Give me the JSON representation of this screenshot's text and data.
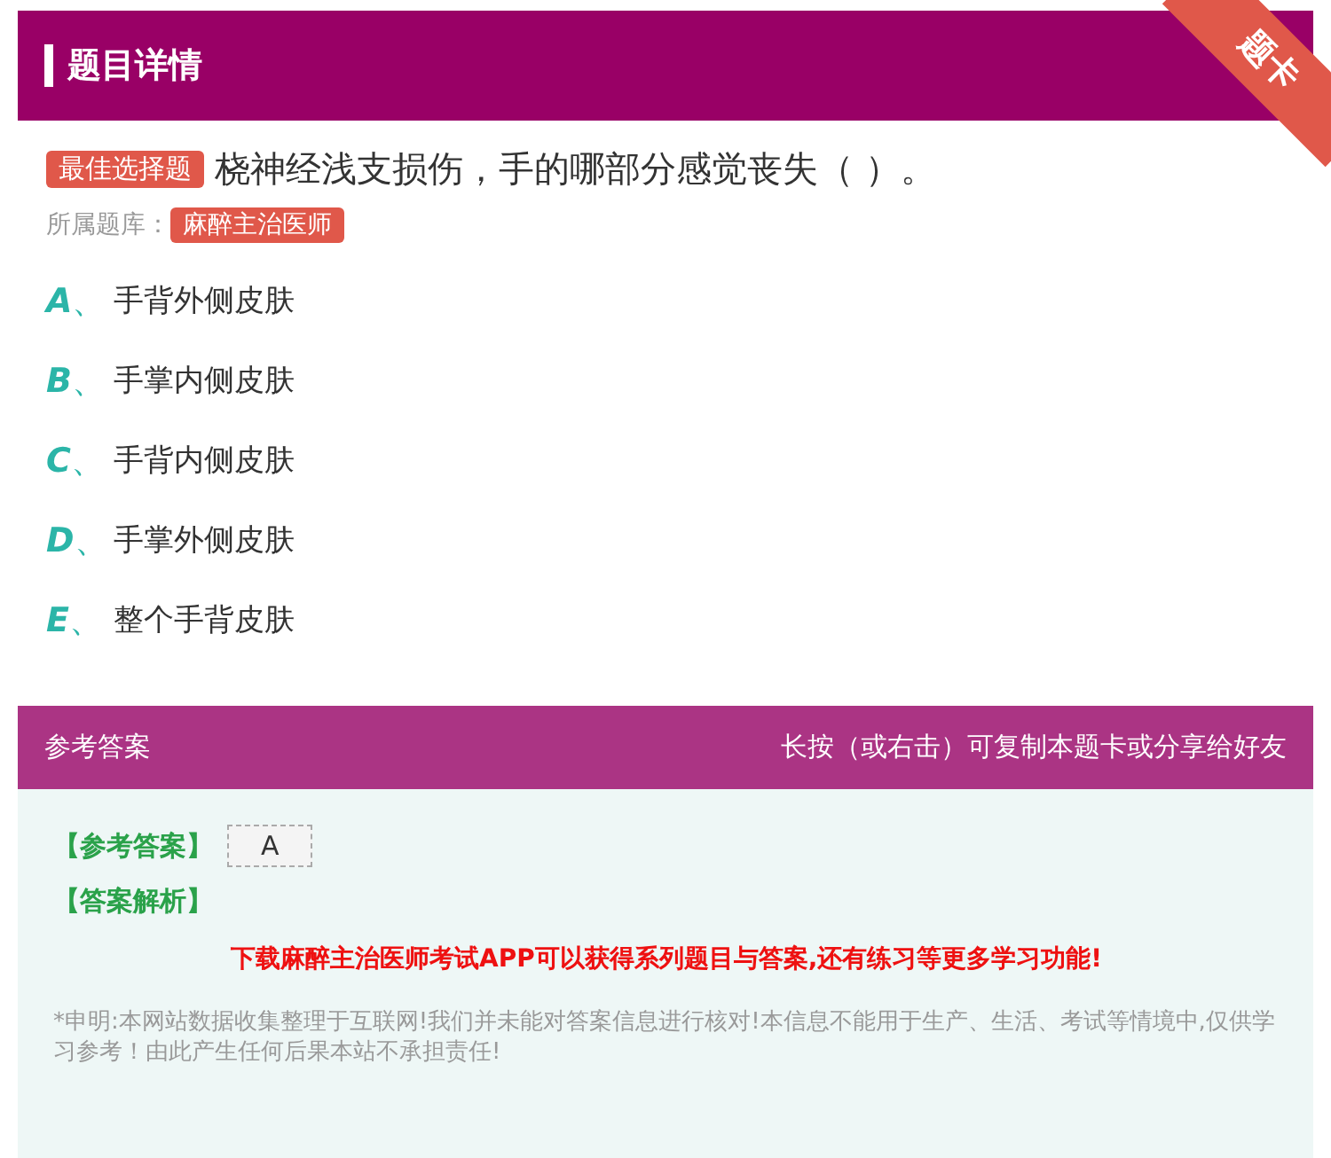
{
  "header": {
    "title": "题目详情",
    "ribbon": "题卡"
  },
  "question": {
    "type_badge": "最佳选择题",
    "text": "桡神经浅支损伤，手的哪部分感觉丧失（ ）。",
    "bank_label": "所属题库：",
    "bank": "麻醉主治医师"
  },
  "options": [
    {
      "letter": "A",
      "separator": "、",
      "text": "手背外侧皮肤"
    },
    {
      "letter": "B",
      "separator": "、",
      "text": "手掌内侧皮肤"
    },
    {
      "letter": "C",
      "separator": "、",
      "text": "手背内侧皮肤"
    },
    {
      "letter": "D",
      "separator": "、",
      "text": "手掌外侧皮肤"
    },
    {
      "letter": "E",
      "separator": "、",
      "text": "整个手背皮肤"
    }
  ],
  "answer_bar": {
    "title": "参考答案",
    "hint": "长按（或右击）可复制本题卡或分享给好友"
  },
  "answer": {
    "label": "【参考答案】",
    "value": "A",
    "analysis_label": "【答案解析】",
    "promo": "下载麻醉主治医师考试APP可以获得系列题目与答案,还有练习等更多学习功能!",
    "disclaimer": "*申明:本网站数据收集整理于互联网!我们并未能对答案信息进行核对!本信息不能用于生产、生活、考试等情境中,仅供学习参考！由此产生任何后果本站不承担责任!"
  }
}
